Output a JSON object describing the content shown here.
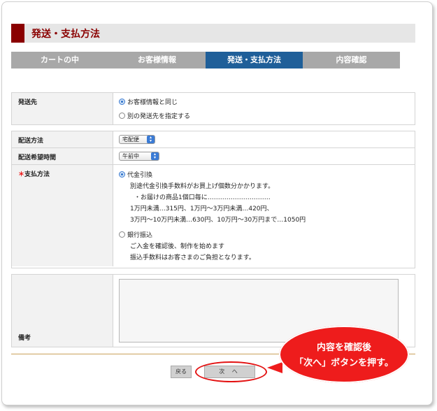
{
  "header": {
    "title": "発送・支払方法"
  },
  "steps": [
    {
      "label": "カートの中",
      "active": false
    },
    {
      "label": "お客様情報",
      "active": false
    },
    {
      "label": "発送・支払方法",
      "active": true
    },
    {
      "label": "内容確認",
      "active": false
    }
  ],
  "shipping_destination": {
    "label": "発送先",
    "options": [
      {
        "label": "お客様情報と同じ",
        "selected": true
      },
      {
        "label": "別の発送先を指定する",
        "selected": false
      }
    ]
  },
  "delivery_method": {
    "label": "配送方法",
    "selected": "宅配便"
  },
  "delivery_time": {
    "label": "配送希望時間",
    "selected": "午前中"
  },
  "payment": {
    "required_mark": "＊",
    "label": "支払方法",
    "cod": {
      "label": "代金引換",
      "selected": true,
      "lines": [
        "別途代金引換手数料がお買上げ個数分かかります。",
        "・お届けの商品1個口毎に…………………………",
        "1万円未満…315円、1万円～3万円未満…420円、",
        "3万円～10万円未満…630円、10万円～30万円まで…1050円"
      ]
    },
    "bank": {
      "label": "銀行振込",
      "selected": false,
      "lines": [
        "ご入金を確認後、制作を始めます",
        "振込手数料はお客さまのご負担となります。"
      ]
    }
  },
  "remarks": {
    "label": "備考",
    "value": ""
  },
  "buttons": {
    "back": "戻る",
    "next": "次 へ"
  },
  "callout": {
    "line1": "内容を確認後",
    "line2": "「次へ」ボタンを押す。"
  },
  "colors": {
    "accent": "#8a0000",
    "active_step": "#1f5f99",
    "callout": "#ee1c1c"
  }
}
